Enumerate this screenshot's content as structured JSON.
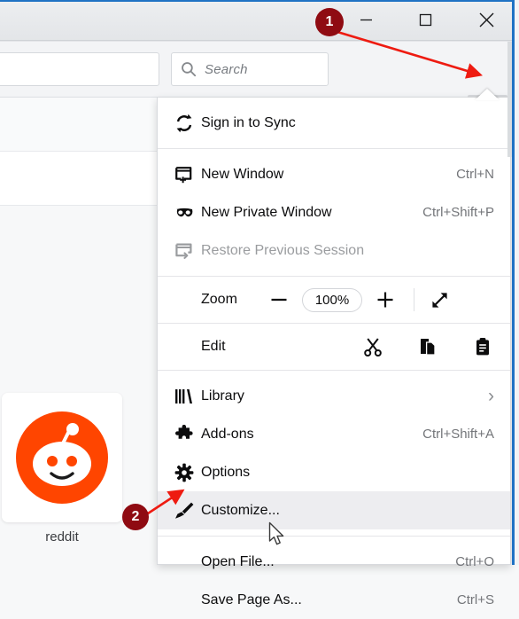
{
  "window": {
    "controls": [
      {
        "name": "minimize",
        "glyph": "—"
      },
      {
        "name": "maximize",
        "glyph": "□"
      },
      {
        "name": "close",
        "glyph": "✕"
      }
    ]
  },
  "toolbar": {
    "url_value": "",
    "search_placeholder": "Search",
    "search_icon": "search-icon",
    "library_icon": "library-icon",
    "sidebar_icon": "sidebar-icon",
    "menu_icon": "hamburger-menu-icon"
  },
  "newtab": {
    "tile_label": "reddit",
    "tile_icon": "reddit-logo"
  },
  "menu": {
    "sync": {
      "label": "Sign in to Sync",
      "icon": "sync-icon",
      "shortcut": ""
    },
    "items": [
      {
        "label": "New Window",
        "shortcut": "Ctrl+N",
        "icon": "new-window-icon",
        "disabled": false
      },
      {
        "label": "New Private Window",
        "shortcut": "Ctrl+Shift+P",
        "icon": "mask-icon",
        "disabled": false
      },
      {
        "label": "Restore Previous Session",
        "shortcut": "",
        "icon": "restore-session-icon",
        "disabled": true
      }
    ],
    "zoom": {
      "label": "Zoom",
      "minus": "−",
      "value": "100%",
      "plus": "+",
      "fullscreen_icon": "fullscreen-icon"
    },
    "edit": {
      "label": "Edit",
      "cut_icon": "scissors-icon",
      "copy_icon": "copy-icon",
      "paste_icon": "clipboard-paste-icon"
    },
    "items2": [
      {
        "label": "Library",
        "shortcut": "",
        "icon": "library-books-icon",
        "chevron": "›",
        "highlighted": false
      },
      {
        "label": "Add-ons",
        "shortcut": "Ctrl+Shift+A",
        "icon": "puzzle-piece-icon",
        "chevron": "",
        "highlighted": false
      },
      {
        "label": "Options",
        "shortcut": "",
        "icon": "gear-icon",
        "chevron": "",
        "highlighted": false
      },
      {
        "label": "Customize...",
        "shortcut": "",
        "icon": "paintbrush-icon",
        "chevron": "",
        "highlighted": true
      }
    ],
    "items3": [
      {
        "label": "Open File...",
        "shortcut": "Ctrl+O",
        "icon": ""
      },
      {
        "label": "Save Page As...",
        "shortcut": "Ctrl+S",
        "icon": ""
      }
    ]
  },
  "annotations": {
    "step1": "1",
    "step2": "2",
    "accent_color": "#8f0b12",
    "arrow_color": "#ee1b11"
  },
  "colors": {
    "brand_blue": "#1f72c4",
    "reddit_orange": "#ff4500",
    "menu_bg": "#ffffff",
    "highlight_bg": "#ededf0"
  }
}
